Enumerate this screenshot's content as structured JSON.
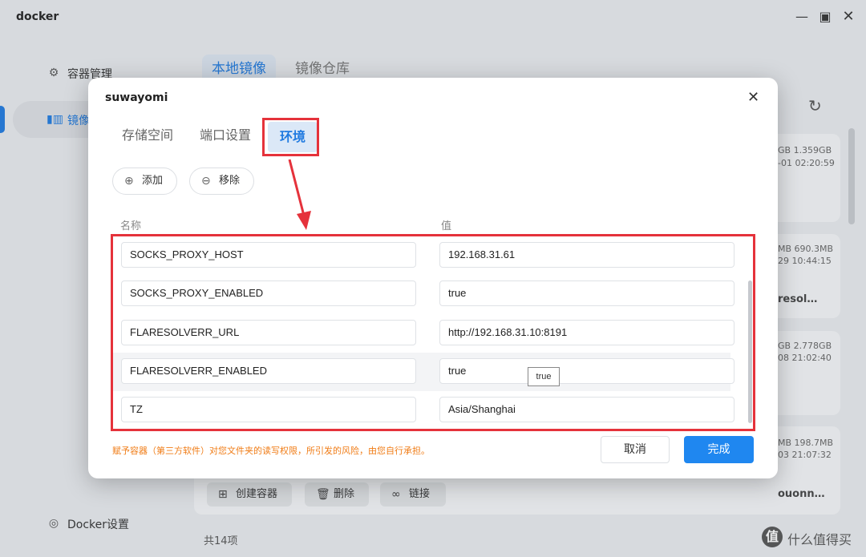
{
  "window": {
    "title": "docker",
    "minimize_icon": "minimize-icon",
    "maximize_icon": "maximize-icon",
    "close_icon": "close-icon"
  },
  "sidebar": {
    "items": [
      {
        "label": "容器管理",
        "icon": "gear-icon"
      },
      {
        "label": "镜像",
        "icon": "image-icon",
        "active": true
      },
      {
        "label": "Docker设置",
        "icon": "settings-icon"
      }
    ]
  },
  "main": {
    "tabs": [
      {
        "label": "本地镜像",
        "active": true
      },
      {
        "label": "镜像仓库"
      }
    ],
    "cards": [
      {
        "meta1": "GB 1.359GB",
        "meta2": "-01 02:20:59",
        "name": ""
      },
      {
        "meta1": "MB 690.3MB",
        "meta2": "29 10:44:15",
        "name": "resol…"
      },
      {
        "meta1": "GB 2.778GB",
        "meta2": "08 21:02:40",
        "name": ""
      },
      {
        "meta1": "MB 198.7MB",
        "meta2": "03 21:07:32",
        "name": "ouonn…"
      }
    ],
    "actions": {
      "create": "创建容器",
      "delete": "删除",
      "link": "链接"
    },
    "footer_count": "共14项"
  },
  "watermark": {
    "logo": "值",
    "text": "什么值得买"
  },
  "modal": {
    "title": "suwayomi",
    "tabs": [
      {
        "label": "存储空间"
      },
      {
        "label": "端口设置"
      },
      {
        "label": "环境",
        "active": true
      }
    ],
    "add_label": "添加",
    "remove_label": "移除",
    "col_name": "名称",
    "col_value": "值",
    "env": [
      {
        "key": "SOCKS_PROXY_HOST",
        "value": "192.168.31.61"
      },
      {
        "key": "SOCKS_PROXY_ENABLED",
        "value": "true"
      },
      {
        "key": "FLARESOLVERR_URL",
        "value": "http://192.168.31.10:8191"
      },
      {
        "key": "FLARESOLVERR_ENABLED",
        "value": "true"
      },
      {
        "key": "TZ",
        "value": "Asia/Shanghai"
      }
    ],
    "tooltip": "true",
    "warning": "赋予容器（第三方软件）对您文件夹的读写权限，所引发的风险，由您自行承担。",
    "cancel_label": "取消",
    "done_label": "完成"
  },
  "colors": {
    "accent": "#1f7ae0",
    "primary_button": "#1f87f0",
    "highlight": "#e5323b",
    "warning": "#f07c16"
  }
}
